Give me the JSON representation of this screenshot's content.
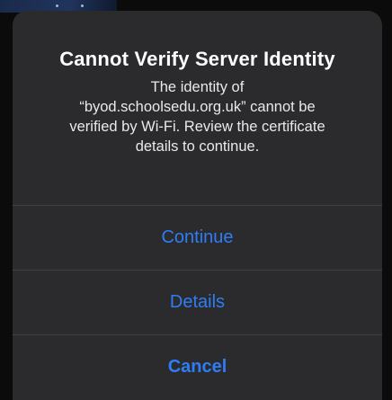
{
  "dialog": {
    "title": "Cannot Verify Server Identity",
    "message_lines": [
      "The identity of",
      "“byod.schoolsedu.org.uk” cannot be",
      "verified by Wi-Fi. Review the certificate",
      "details to continue."
    ],
    "buttons": {
      "continue": "Continue",
      "details": "Details",
      "cancel": "Cancel"
    }
  },
  "colors": {
    "dialog_background": "#2b2b2d",
    "button_text": "#2f7df6",
    "separator": "#414145",
    "screen_background": "#0b0b0b"
  }
}
